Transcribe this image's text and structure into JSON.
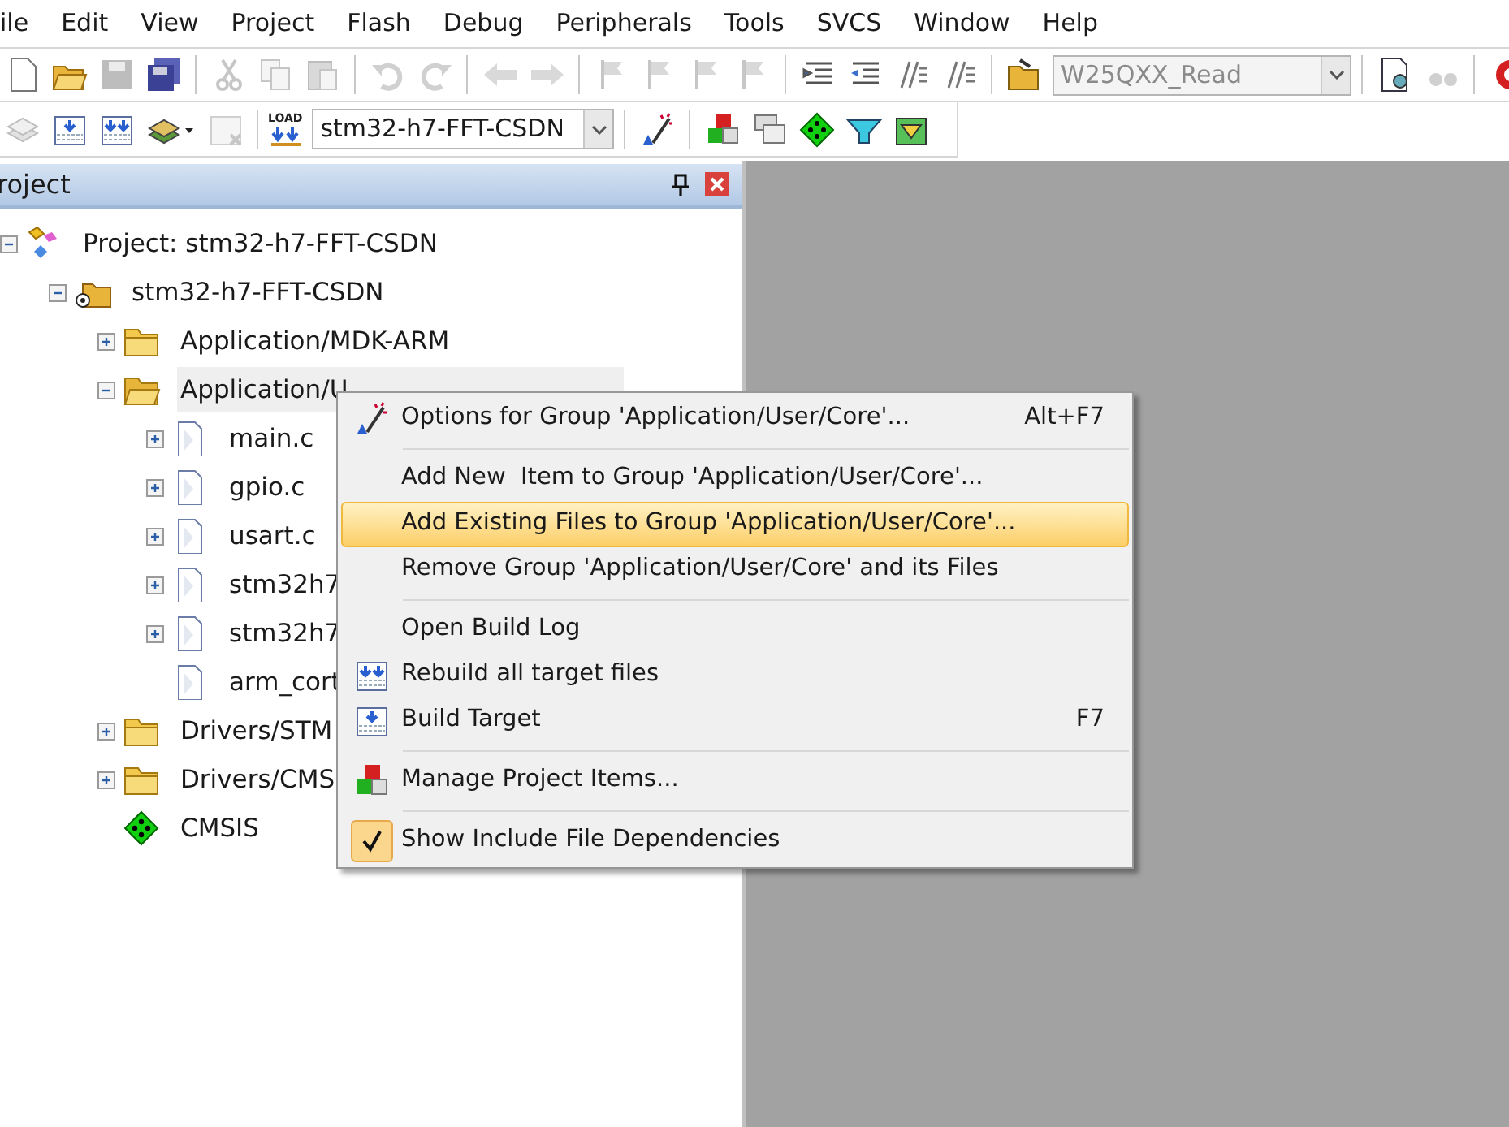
{
  "menu_bar": [
    "ile",
    "Edit",
    "View",
    "Project",
    "Flash",
    "Debug",
    "Peripherals",
    "Tools",
    "SVCS",
    "Window",
    "Help"
  ],
  "toolbars": [
    {
      "buttons": [
        {
          "disabled": false
        },
        {
          "disabled": false
        },
        {
          "disabled": true
        },
        {
          "disabled": false
        },
        {
          "disabled": true
        },
        {
          "disabled": true
        },
        {
          "disabled": true
        },
        {
          "disabled": true
        },
        {
          "disabled": true
        },
        {
          "disabled": true
        },
        {
          "disabled": true
        },
        {
          "disabled": true
        },
        {
          "disabled": true
        },
        {
          "disabled": true
        },
        {
          "disabled": true
        },
        {
          "disabled": false
        },
        {
          "disabled": false
        },
        {
          "disabled": false
        },
        {
          "disabled": false
        },
        {
          "disabled": false
        }
      ],
      "combo": {
        "value": "W25QXX_Read",
        "disabled": true
      },
      "after_combo": [
        {
          "disabled": false
        },
        {
          "disabled": true
        },
        {
          "disabled": false
        }
      ]
    },
    {
      "buttons": [
        {
          "disabled": true
        },
        {
          "disabled": false
        },
        {
          "disabled": false
        },
        {
          "disabled": false
        },
        {
          "disabled": true
        },
        {
          "disabled": false
        }
      ],
      "load_label": "LOAD",
      "combo": {
        "value": "stm32-h7-FFT-CSDN",
        "disabled": false
      },
      "after_combo": [
        {
          "disabled": false
        },
        {
          "disabled": false
        },
        {
          "disabled": false
        },
        {
          "disabled": false
        },
        {
          "disabled": false
        },
        {
          "disabled": false
        }
      ]
    }
  ],
  "project_panel": {
    "title": "roject",
    "tree": [
      {
        "kind": "project",
        "label": "Project: stm32-h7-FFT-CSDN",
        "expanded": true,
        "selected": false,
        "children": [
          {
            "kind": "target",
            "label": "stm32-h7-FFT-CSDN",
            "expanded": true,
            "selected": false,
            "children": [
              {
                "kind": "group",
                "label": "Application/MDK-ARM",
                "expanded": false,
                "selected": false
              },
              {
                "kind": "group",
                "label": "Application/U",
                "expanded": true,
                "selected": true,
                "children": [
                  {
                    "kind": "file",
                    "label": "main.c",
                    "expanded": false,
                    "selected": false
                  },
                  {
                    "kind": "file",
                    "label": "gpio.c",
                    "expanded": false,
                    "selected": false
                  },
                  {
                    "kind": "file",
                    "label": "usart.c",
                    "expanded": false,
                    "selected": false
                  },
                  {
                    "kind": "file",
                    "label": "stm32h7",
                    "expanded": false,
                    "selected": false
                  },
                  {
                    "kind": "file",
                    "label": "stm32h7",
                    "expanded": false,
                    "selected": false
                  },
                  {
                    "kind": "leaf",
                    "label": "arm_cort",
                    "selected": false
                  }
                ]
              },
              {
                "kind": "group",
                "label": "Drivers/STM",
                "expanded": false,
                "selected": false
              },
              {
                "kind": "group",
                "label": "Drivers/CMS",
                "expanded": false,
                "selected": false
              },
              {
                "kind": "component",
                "label": "CMSIS",
                "selected": false
              }
            ]
          }
        ]
      }
    ]
  },
  "context_menu": [
    {
      "kind": "item",
      "label": "Options for Group 'Application/User/Core'...",
      "shortcut": "Alt+F7",
      "selected": false,
      "checked": false
    },
    {
      "kind": "separator"
    },
    {
      "kind": "item",
      "label": "Add New  Item to Group 'Application/User/Core'...",
      "selected": false,
      "checked": false
    },
    {
      "kind": "item",
      "label": "Add Existing Files to Group 'Application/User/Core'...",
      "selected": true,
      "checked": false
    },
    {
      "kind": "item",
      "label": "Remove Group 'Application/User/Core' and its Files",
      "selected": false,
      "checked": false
    },
    {
      "kind": "separator"
    },
    {
      "kind": "item",
      "label": "Open Build Log",
      "selected": false,
      "checked": false
    },
    {
      "kind": "item",
      "label": "Rebuild all target files",
      "selected": false,
      "checked": false
    },
    {
      "kind": "item",
      "label": "Build Target",
      "shortcut": "F7",
      "selected": false,
      "checked": false
    },
    {
      "kind": "separator"
    },
    {
      "kind": "item",
      "label": "Manage Project Items...",
      "selected": false,
      "checked": false
    },
    {
      "kind": "separator"
    },
    {
      "kind": "item",
      "label": "Show Include File Dependencies",
      "selected": false,
      "checked": true
    }
  ]
}
